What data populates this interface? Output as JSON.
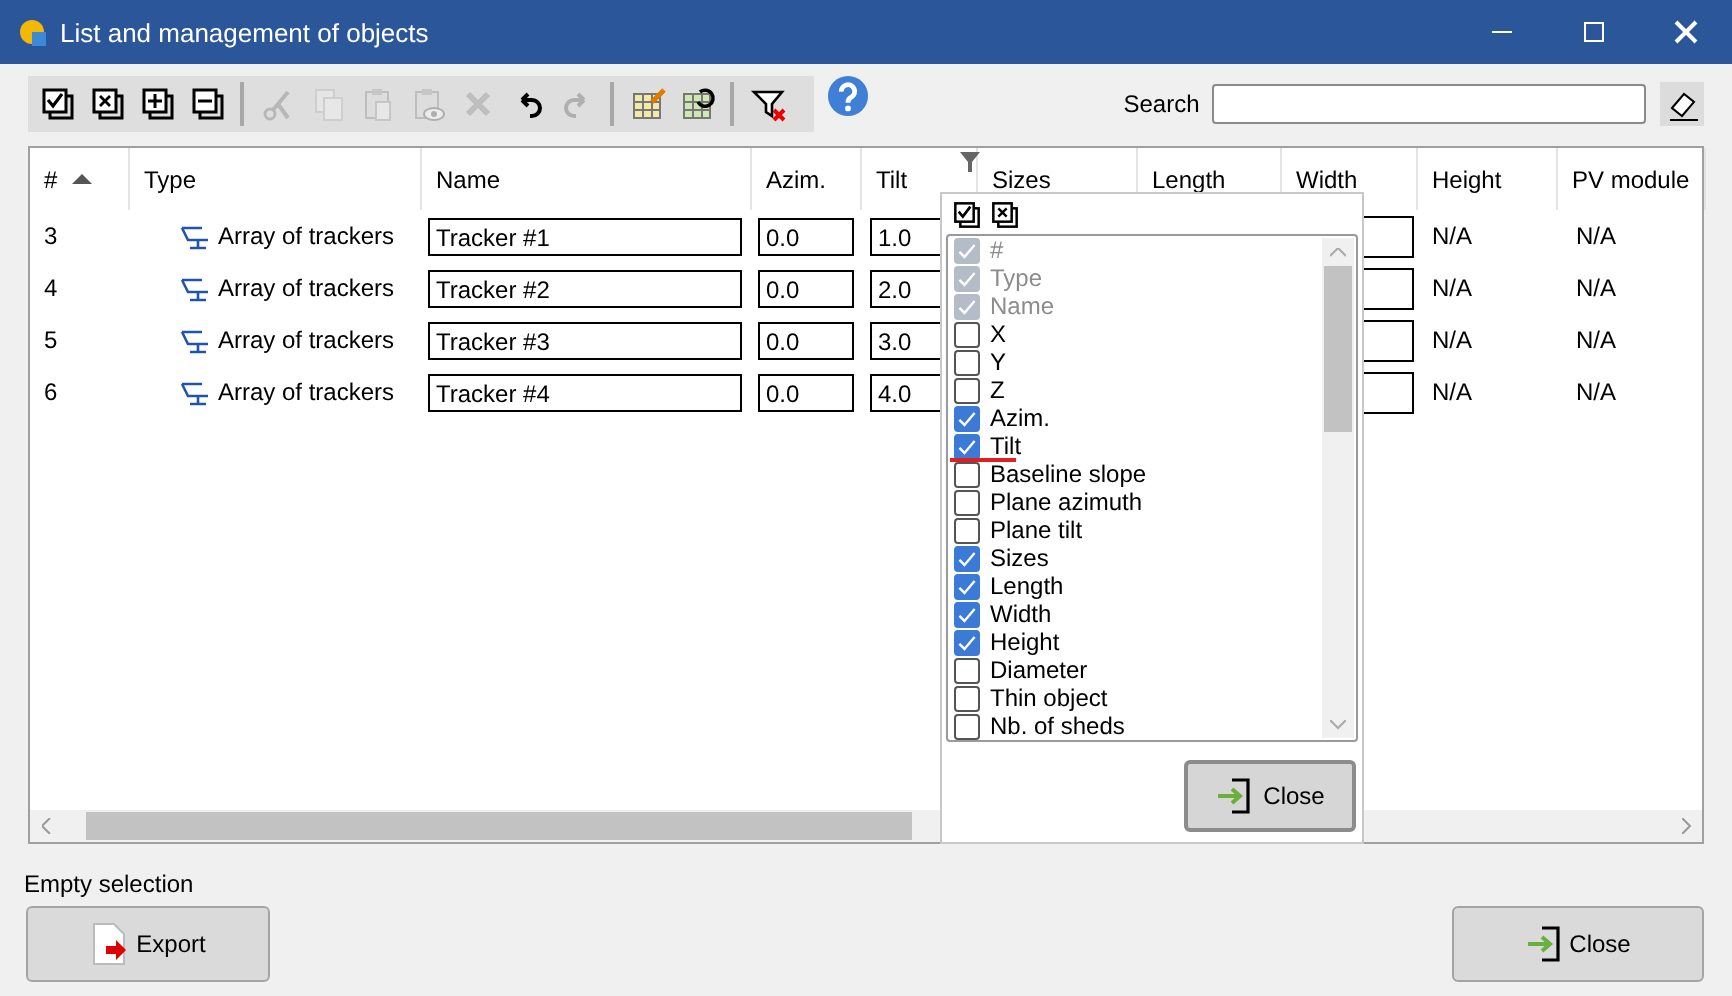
{
  "window": {
    "title": "List and management of objects"
  },
  "toolbar": [
    {
      "kind": "check-all",
      "disabled": false
    },
    {
      "kind": "uncheck-all",
      "disabled": false
    },
    {
      "kind": "expand",
      "disabled": false
    },
    {
      "kind": "collapse",
      "disabled": false
    },
    {
      "kind": "separator"
    },
    {
      "kind": "cut",
      "disabled": true
    },
    {
      "kind": "copy",
      "disabled": true
    },
    {
      "kind": "paste",
      "disabled": true
    },
    {
      "kind": "paste-view",
      "disabled": true
    },
    {
      "kind": "delete",
      "disabled": true
    },
    {
      "kind": "undo",
      "disabled": false
    },
    {
      "kind": "redo",
      "disabled": true
    },
    {
      "kind": "separator"
    },
    {
      "kind": "table-edit",
      "disabled": false
    },
    {
      "kind": "table-refresh",
      "disabled": false
    },
    {
      "kind": "separator"
    },
    {
      "kind": "filter-clear",
      "disabled": false
    },
    {
      "kind": "help",
      "disabled": false
    }
  ],
  "search": {
    "label": "Search"
  },
  "table": {
    "columns": [
      {
        "label": "#",
        "sorted": true
      },
      {
        "label": "Type",
        "sorted": false
      },
      {
        "label": "Name",
        "sorted": false
      },
      {
        "label": "Azim.",
        "sorted": false
      },
      {
        "label": "Tilt",
        "sorted": false
      },
      {
        "label": "Sizes",
        "sorted": false
      },
      {
        "label": "Length",
        "sorted": false
      },
      {
        "label": "Width",
        "sorted": false
      },
      {
        "label": "Height",
        "sorted": false
      },
      {
        "label": "PV module",
        "sorted": false
      }
    ],
    "rows": [
      {
        "number": "3",
        "type": "Array of trackers",
        "name": "Tracker #1",
        "azim": "0.0",
        "tilt": "1.0",
        "height": "N/A",
        "pv_module": "N/A"
      },
      {
        "number": "4",
        "type": "Array of trackers",
        "name": "Tracker #2",
        "azim": "0.0",
        "tilt": "2.0",
        "height": "N/A",
        "pv_module": "N/A"
      },
      {
        "number": "5",
        "type": "Array of trackers",
        "name": "Tracker #3",
        "azim": "0.0",
        "tilt": "3.0",
        "height": "N/A",
        "pv_module": "N/A"
      },
      {
        "number": "6",
        "type": "Array of trackers",
        "name": "Tracker #4",
        "azim": "0.0",
        "tilt": "4.0",
        "height": "N/A",
        "pv_module": "N/A"
      }
    ]
  },
  "column_chooser": {
    "items": [
      {
        "label": "#",
        "checked": true,
        "disabled": true,
        "underlined": false
      },
      {
        "label": "Type",
        "checked": true,
        "disabled": true,
        "underlined": false
      },
      {
        "label": "Name",
        "checked": true,
        "disabled": true,
        "underlined": false
      },
      {
        "label": "X",
        "checked": false,
        "disabled": false,
        "underlined": false
      },
      {
        "label": "Y",
        "checked": false,
        "disabled": false,
        "underlined": false
      },
      {
        "label": "Z",
        "checked": false,
        "disabled": false,
        "underlined": false
      },
      {
        "label": "Azim.",
        "checked": true,
        "disabled": false,
        "underlined": false
      },
      {
        "label": "Tilt",
        "checked": true,
        "disabled": false,
        "underlined": true
      },
      {
        "label": "Baseline slope",
        "checked": false,
        "disabled": false,
        "underlined": false
      },
      {
        "label": "Plane azimuth",
        "checked": false,
        "disabled": false,
        "underlined": false
      },
      {
        "label": "Plane tilt",
        "checked": false,
        "disabled": false,
        "underlined": false
      },
      {
        "label": "Sizes",
        "checked": true,
        "disabled": false,
        "underlined": false
      },
      {
        "label": "Length",
        "checked": true,
        "disabled": false,
        "underlined": false
      },
      {
        "label": "Width",
        "checked": true,
        "disabled": false,
        "underlined": false
      },
      {
        "label": "Height",
        "checked": true,
        "disabled": false,
        "underlined": false
      },
      {
        "label": "Diameter",
        "checked": false,
        "disabled": false,
        "underlined": false
      },
      {
        "label": "Thin object",
        "checked": false,
        "disabled": false,
        "underlined": false
      },
      {
        "label": "Nb. of sheds",
        "checked": false,
        "disabled": false,
        "underlined": false
      }
    ],
    "close_button": "Close"
  },
  "status": "Empty selection",
  "buttons": {
    "export": "Export",
    "close": "Close"
  }
}
